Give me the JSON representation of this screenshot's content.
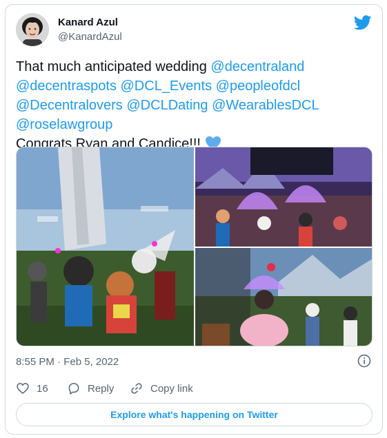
{
  "author": {
    "name": "Kanard Azul",
    "handle": "@KanardAzul"
  },
  "tweet": {
    "intro": "That much anticipated wedding ",
    "mentions": [
      "@decentraland",
      "@decentraspots",
      "@DCL_Events",
      "@peopleofdcl",
      "@Decentralovers",
      "@DCLDating",
      "@WearablesDCL",
      "@roselawgroup"
    ],
    "congrats": "Congrats Ryan and Candice!!! "
  },
  "timestamp": "8:55 PM · Feb 5, 2022",
  "actions": {
    "like_count": "16",
    "reply_label": "Reply",
    "copy_label": "Copy link"
  },
  "explore_label": "Explore what's happening on Twitter",
  "colors": {
    "brand": "#1d9bf0",
    "text": "#0f1419",
    "secondary": "#536471",
    "border": "#cfd9de"
  },
  "icons": [
    "twitter-bird-icon",
    "info-icon",
    "heart-icon",
    "reply-icon",
    "link-icon",
    "blue-heart-emoji"
  ]
}
